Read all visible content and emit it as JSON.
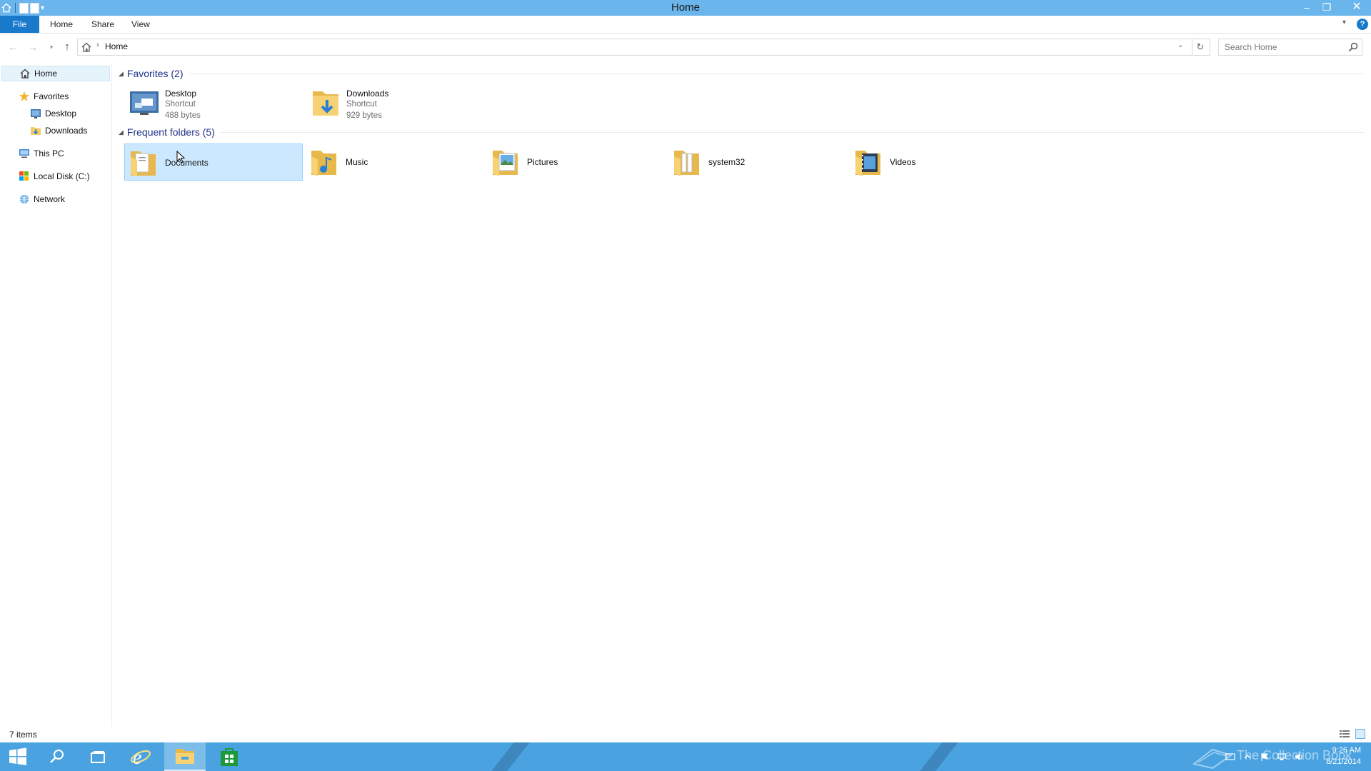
{
  "window": {
    "title": "Home",
    "controls": {
      "minimize": "–",
      "maximize": "❐",
      "close": "✕"
    }
  },
  "ribbon": {
    "tabs": [
      {
        "label": "File",
        "active": true
      },
      {
        "label": "Home"
      },
      {
        "label": "Share"
      },
      {
        "label": "View"
      }
    ],
    "help_label": "?"
  },
  "address": {
    "path": "Home",
    "search_placeholder": "Search Home"
  },
  "nav_pane": {
    "items": [
      {
        "label": "Home",
        "icon": "home-icon",
        "selected": true
      },
      {
        "label": "Favorites",
        "icon": "star-icon"
      },
      {
        "label": "Desktop",
        "icon": "desktop-icon"
      },
      {
        "label": "Downloads",
        "icon": "downloads-folder-icon"
      },
      {
        "label": "This PC",
        "icon": "computer-icon"
      },
      {
        "label": "Local Disk (C:)",
        "icon": "drive-icon"
      },
      {
        "label": "Network",
        "icon": "network-icon"
      }
    ]
  },
  "groups": {
    "favorites": {
      "title": "Favorites (2)",
      "items": [
        {
          "name": "Desktop",
          "type": "Shortcut",
          "size": "488 bytes",
          "icon": "desktop-shortcut-icon"
        },
        {
          "name": "Downloads",
          "type": "Shortcut",
          "size": "929 bytes",
          "icon": "downloads-folder-icon"
        }
      ]
    },
    "frequent": {
      "title": "Frequent folders (5)",
      "items": [
        {
          "name": "Documents",
          "icon": "documents-folder-icon",
          "selected": true
        },
        {
          "name": "Music",
          "icon": "music-folder-icon"
        },
        {
          "name": "Pictures",
          "icon": "pictures-folder-icon"
        },
        {
          "name": "system32",
          "icon": "system-folder-icon"
        },
        {
          "name": "Videos",
          "icon": "videos-folder-icon"
        }
      ]
    }
  },
  "status": {
    "item_count": "7 items"
  },
  "taskbar": {
    "pinned": [
      "start",
      "search",
      "task-view",
      "internet-explorer",
      "file-explorer",
      "store"
    ],
    "active": "file-explorer",
    "clock": {
      "time": "9:26 AM",
      "date": "8/21/2014"
    },
    "watermark": "The Collection Book"
  },
  "colors": {
    "titlebar": "#6ab5ec",
    "file_tab": "#1979ca",
    "group_title": "#1e3287",
    "selection": "#cce8ff",
    "taskbar": "#4aa3e0"
  }
}
